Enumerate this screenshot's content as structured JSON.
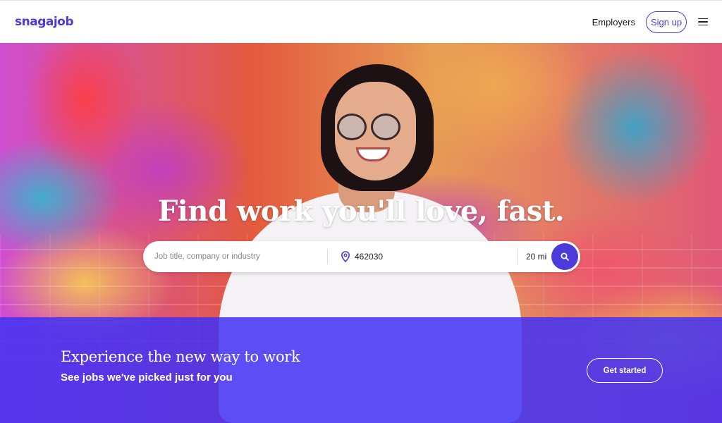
{
  "header": {
    "logo": "snagajob",
    "employers_label": "Employers",
    "signup_label": "Sign up",
    "menu_icon": "hamburger-menu-icon"
  },
  "hero": {
    "headline": "Find work you'll love, fast.",
    "search": {
      "job_placeholder": "Job title, company or industry",
      "job_value": "",
      "location_value": "462030",
      "location_icon": "location-pin-icon",
      "radius_value": "20 mi",
      "search_icon": "search-icon"
    }
  },
  "promo": {
    "title": "Experience the new way to work",
    "subtitle": "See jobs we've picked just for you",
    "cta_label": "Get started"
  },
  "colors": {
    "brand": "#4b3bdb",
    "band": "#4232f5"
  }
}
